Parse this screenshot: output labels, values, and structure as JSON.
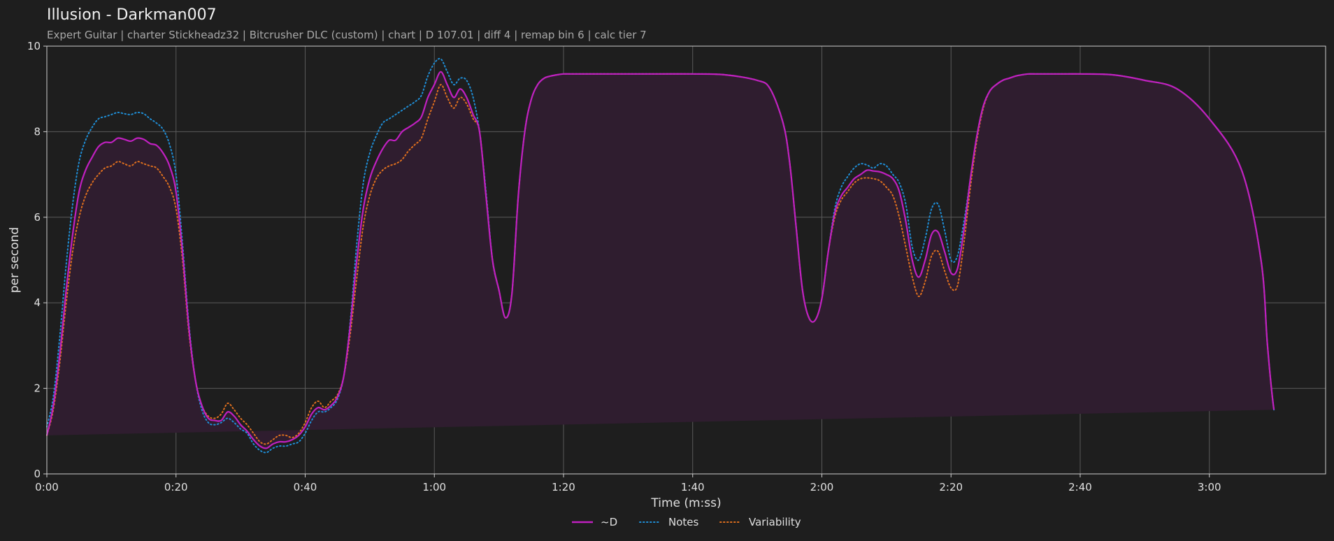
{
  "header": {
    "title": "Illusion - Darkman007",
    "subtitle": "Expert Guitar  |  charter Stickheadz32  |  Bitcrusher DLC (custom)  |  chart  |  D 107.01  |  diff 4  |  remap bin 6  |  calc tier 7"
  },
  "colors": {
    "background": "#1e1e1e",
    "d_line": "#c020c0",
    "fill": "#2f1d2f",
    "notes": "#1f8ed6",
    "variability": "#e0701e",
    "grid": "#5a5a5a",
    "axis": "#cfcfcf"
  },
  "chart_data": {
    "type": "line",
    "title": "Illusion - Darkman007",
    "xlabel": "Time (m:ss)",
    "ylabel": "per second",
    "xlim": [
      0,
      198
    ],
    "ylim": [
      0,
      10
    ],
    "grid": true,
    "legend_position": "bottom-center",
    "x_ticks": [
      0,
      20,
      40,
      60,
      80,
      100,
      120,
      140,
      160,
      180
    ],
    "x_tick_labels": [
      "0:00",
      "0:20",
      "0:40",
      "1:00",
      "1:20",
      "1:40",
      "2:00",
      "2:20",
      "2:40",
      "3:00"
    ],
    "y_ticks": [
      0,
      2,
      4,
      6,
      8,
      10
    ],
    "y_tick_labels": [
      "0",
      "2",
      "4",
      "6",
      "8",
      "10"
    ],
    "x": [
      0,
      1,
      2,
      3,
      4,
      5,
      6,
      7,
      8,
      9,
      10,
      11,
      12,
      13,
      14,
      15,
      16,
      17,
      18,
      19,
      20,
      21,
      22,
      23,
      24,
      25,
      26,
      27,
      28,
      29,
      30,
      31,
      32,
      33,
      34,
      35,
      36,
      37,
      38,
      39,
      40,
      41,
      42,
      43,
      44,
      45,
      46,
      47,
      48,
      49,
      50,
      51,
      52,
      53,
      54,
      55,
      56,
      57,
      58,
      59,
      60,
      61,
      62,
      63,
      64,
      65,
      66,
      67,
      68,
      69,
      70,
      71,
      72,
      73,
      74,
      75,
      76,
      77,
      78,
      79,
      80,
      81,
      82,
      83,
      84,
      85,
      90,
      95,
      100,
      105,
      110,
      112,
      114,
      115,
      116,
      117,
      118,
      119,
      120,
      121,
      122,
      123,
      124,
      125,
      126,
      127,
      128,
      129,
      130,
      131,
      132,
      133,
      134,
      135,
      136,
      137,
      138,
      139,
      140,
      141,
      142,
      143,
      144,
      145,
      146,
      147,
      148,
      149,
      150,
      151,
      152,
      153,
      154,
      155,
      156,
      157,
      158,
      160,
      165,
      170,
      175,
      180,
      185,
      188,
      189,
      190,
      191,
      192,
      193,
      194,
      195,
      196,
      197,
      198
    ],
    "series": [
      {
        "name": "~D",
        "style": "solid",
        "values": [
          0.9,
          1.6,
          2.8,
          4.3,
          5.6,
          6.6,
          7.1,
          7.4,
          7.65,
          7.75,
          7.75,
          7.85,
          7.82,
          7.78,
          7.85,
          7.82,
          7.72,
          7.68,
          7.5,
          7.2,
          6.6,
          5.2,
          3.4,
          2.2,
          1.6,
          1.3,
          1.25,
          1.25,
          1.45,
          1.35,
          1.15,
          1.0,
          0.8,
          0.65,
          0.6,
          0.7,
          0.75,
          0.75,
          0.8,
          0.9,
          1.1,
          1.4,
          1.55,
          1.5,
          1.6,
          1.8,
          2.3,
          3.5,
          5.0,
          6.2,
          6.9,
          7.3,
          7.6,
          7.8,
          7.8,
          8.0,
          8.1,
          8.2,
          8.35,
          8.8,
          9.1,
          9.4,
          9.1,
          8.8,
          9.0,
          8.8,
          8.4,
          8.0,
          6.5,
          5.0,
          4.3,
          3.65,
          4.2,
          6.5,
          8.0,
          8.75,
          9.1,
          9.25,
          9.3,
          9.33,
          9.35,
          9.35,
          9.35,
          9.35,
          9.35,
          9.35,
          9.35,
          9.35,
          9.35,
          9.33,
          9.2,
          9.0,
          8.2,
          7.3,
          5.8,
          4.3,
          3.65,
          3.6,
          4.1,
          5.2,
          6.1,
          6.5,
          6.7,
          6.9,
          7.0,
          7.1,
          7.08,
          7.06,
          7.0,
          6.9,
          6.6,
          5.9,
          5.0,
          4.6,
          5.0,
          5.6,
          5.65,
          5.2,
          4.7,
          4.8,
          5.7,
          6.9,
          7.9,
          8.6,
          8.95,
          9.1,
          9.2,
          9.25,
          9.3,
          9.33,
          9.35,
          9.35,
          9.35,
          9.35,
          9.35,
          9.35,
          9.35,
          9.35,
          9.33,
          9.2,
          9.0,
          8.3,
          7.1,
          5.0,
          3.0,
          1.5,
          0.8
        ]
      },
      {
        "name": "Notes",
        "style": "dotted",
        "values": [
          1.1,
          1.8,
          3.2,
          4.9,
          6.3,
          7.3,
          7.8,
          8.1,
          8.3,
          8.35,
          8.4,
          8.45,
          8.42,
          8.4,
          8.45,
          8.42,
          8.3,
          8.2,
          8.05,
          7.7,
          7.0,
          5.4,
          3.5,
          2.2,
          1.5,
          1.2,
          1.15,
          1.2,
          1.3,
          1.2,
          1.05,
          0.95,
          0.7,
          0.55,
          0.5,
          0.6,
          0.65,
          0.65,
          0.7,
          0.75,
          0.95,
          1.25,
          1.45,
          1.45,
          1.55,
          1.75,
          2.3,
          3.6,
          5.4,
          6.8,
          7.5,
          7.9,
          8.2,
          8.3,
          8.4,
          8.5,
          8.6,
          8.7,
          8.85,
          9.3,
          9.6,
          9.7,
          9.4,
          9.1,
          9.25,
          9.2,
          8.8,
          8.0,
          6.6,
          5.0,
          4.3,
          3.65,
          4.2,
          6.5,
          8.0,
          8.75,
          9.1,
          9.25,
          9.3,
          9.33,
          9.35,
          9.35,
          9.35,
          9.35,
          9.35,
          9.35,
          9.35,
          9.35,
          9.35,
          9.33,
          9.2,
          9.0,
          8.2,
          7.3,
          5.8,
          4.3,
          3.65,
          3.6,
          4.1,
          5.2,
          6.2,
          6.7,
          6.95,
          7.15,
          7.25,
          7.22,
          7.15,
          7.25,
          7.2,
          7.0,
          6.8,
          6.3,
          5.3,
          5.0,
          5.5,
          6.2,
          6.3,
          5.7,
          5.0,
          5.1,
          5.9,
          6.9,
          7.9,
          8.6,
          8.95,
          9.1,
          9.2,
          9.25,
          9.3,
          9.33,
          9.35,
          9.35,
          9.35,
          9.35,
          9.35,
          9.35,
          9.35,
          9.35,
          9.33,
          9.2,
          9.0,
          8.3,
          7.1,
          5.0,
          3.0,
          1.5,
          0.8
        ]
      },
      {
        "name": "Variability",
        "style": "dotted",
        "values": [
          0.9,
          1.5,
          2.6,
          4.0,
          5.2,
          6.0,
          6.5,
          6.8,
          7.0,
          7.15,
          7.2,
          7.3,
          7.25,
          7.2,
          7.3,
          7.25,
          7.2,
          7.15,
          6.95,
          6.7,
          6.2,
          5.0,
          3.3,
          2.2,
          1.6,
          1.35,
          1.3,
          1.4,
          1.65,
          1.5,
          1.3,
          1.15,
          0.95,
          0.75,
          0.7,
          0.8,
          0.9,
          0.9,
          0.85,
          0.95,
          1.2,
          1.55,
          1.7,
          1.55,
          1.7,
          1.85,
          2.3,
          3.3,
          4.6,
          5.8,
          6.5,
          6.9,
          7.1,
          7.2,
          7.25,
          7.35,
          7.55,
          7.7,
          7.85,
          8.3,
          8.7,
          9.1,
          8.8,
          8.55,
          8.8,
          8.65,
          8.3,
          8.0,
          6.5,
          5.0,
          4.3,
          3.65,
          4.2,
          6.5,
          8.0,
          8.75,
          9.1,
          9.25,
          9.3,
          9.33,
          9.35,
          9.35,
          9.35,
          9.35,
          9.35,
          9.35,
          9.35,
          9.35,
          9.35,
          9.33,
          9.2,
          9.0,
          8.2,
          7.3,
          5.8,
          4.3,
          3.65,
          3.6,
          4.1,
          5.2,
          6.0,
          6.4,
          6.6,
          6.8,
          6.9,
          6.92,
          6.9,
          6.85,
          6.7,
          6.5,
          6.0,
          5.3,
          4.6,
          4.15,
          4.5,
          5.1,
          5.2,
          4.75,
          4.35,
          4.4,
          5.4,
          6.7,
          7.8,
          8.55,
          8.95,
          9.1,
          9.2,
          9.25,
          9.3,
          9.33,
          9.35,
          9.35,
          9.35,
          9.35,
          9.35,
          9.35,
          9.35,
          9.35,
          9.33,
          9.2,
          9.0,
          8.3,
          7.1,
          5.0,
          3.0,
          1.5,
          0.8
        ]
      }
    ]
  }
}
